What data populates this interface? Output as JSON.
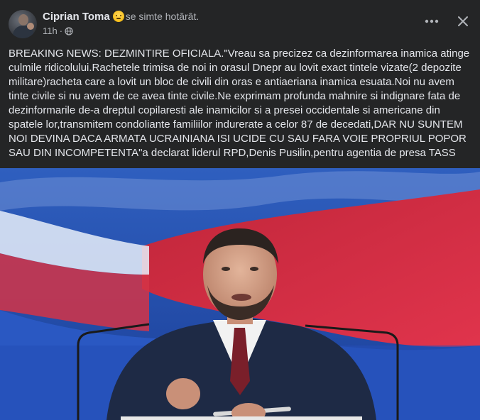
{
  "post": {
    "author": "Ciprian Toma",
    "feeling": "se simte hotărât.",
    "timestamp": "11h",
    "dot": "·",
    "body": "BREAKING NEWS: DEZMINTIRE OFICIALA.\"Vreau sa precizez ca dezinformarea inamica atinge culmile ridicolului.Rachetele trimisa de noi in orasul Dnepr au lovit exact tintele vizate(2 depozite militare)racheta care a lovit un bloc de civili din oras e antiaeriana inamica esuata.Noi nu avem tinte civile si nu avem de ce avea tinte civile.Ne exprimam profunda mahnire si indignare fata de dezinformarile de-a dreptul copilaresti ale inamicilor si a presei occidentale si americane din spatele lor,transmitem condoliante familiilor indurerate a celor 87 de decedati,DAR NU SUNTEM NOI DEVINA DACA ARMATA UCRAINIANA ISI UCIDE CU SAU FARA VOIE PROPRIUL POPOR SAU DIN INCOMPETENTA\"a declarat liderul RPD,Denis Pusilin,pentru agentia de presa TASS"
  },
  "icons": {
    "emoji": "determined-face-emoji",
    "privacy": "globe-icon",
    "more": "more-options-icon",
    "close": "close-icon"
  },
  "colors": {
    "background": "#242526",
    "text_primary": "#e4e6eb",
    "text_secondary": "#b0b3b8"
  }
}
